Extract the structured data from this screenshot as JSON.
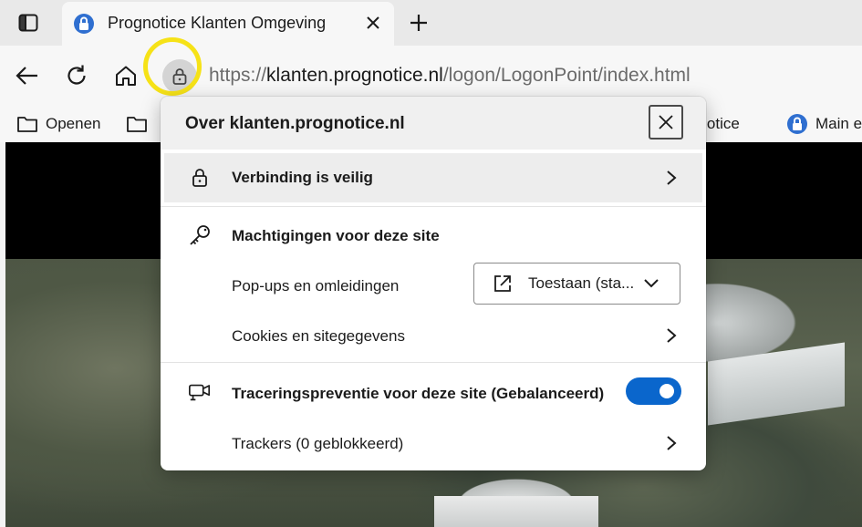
{
  "window": {
    "tab": {
      "title": "Prognotice Klanten Omgeving",
      "favicon": "lock-icon"
    }
  },
  "address_bar": {
    "scheme": "https://",
    "host": "klanten.prognotice.nl",
    "path": "/logon/LogonPoint/index.html"
  },
  "favorites": {
    "items": [
      {
        "label": "Openen",
        "icon": "folder-icon"
      },
      {
        "label": "",
        "icon": "folder-icon"
      },
      {
        "label": "gnotice",
        "icon": ""
      },
      {
        "label": "Main e",
        "icon": "lock-icon"
      }
    ]
  },
  "site_info": {
    "title": "Over klanten.prognotice.nl",
    "connection": {
      "label": "Verbinding is veilig"
    },
    "permissions": {
      "heading": "Machtigingen voor deze site",
      "popups_label": "Pop-ups en omleidingen",
      "popups_value": "Toestaan (sta...",
      "cookies_label": "Cookies en sitegegevens"
    },
    "tracking": {
      "label": "Traceringspreventie voor deze site (Gebalanceerd)",
      "enabled": true,
      "trackers_label": "Trackers (0 geblokkeerd)"
    }
  },
  "colors": {
    "accent": "#0a66cc",
    "highlight_ring": "#f6e217",
    "popup_bg": "#ffffff"
  }
}
